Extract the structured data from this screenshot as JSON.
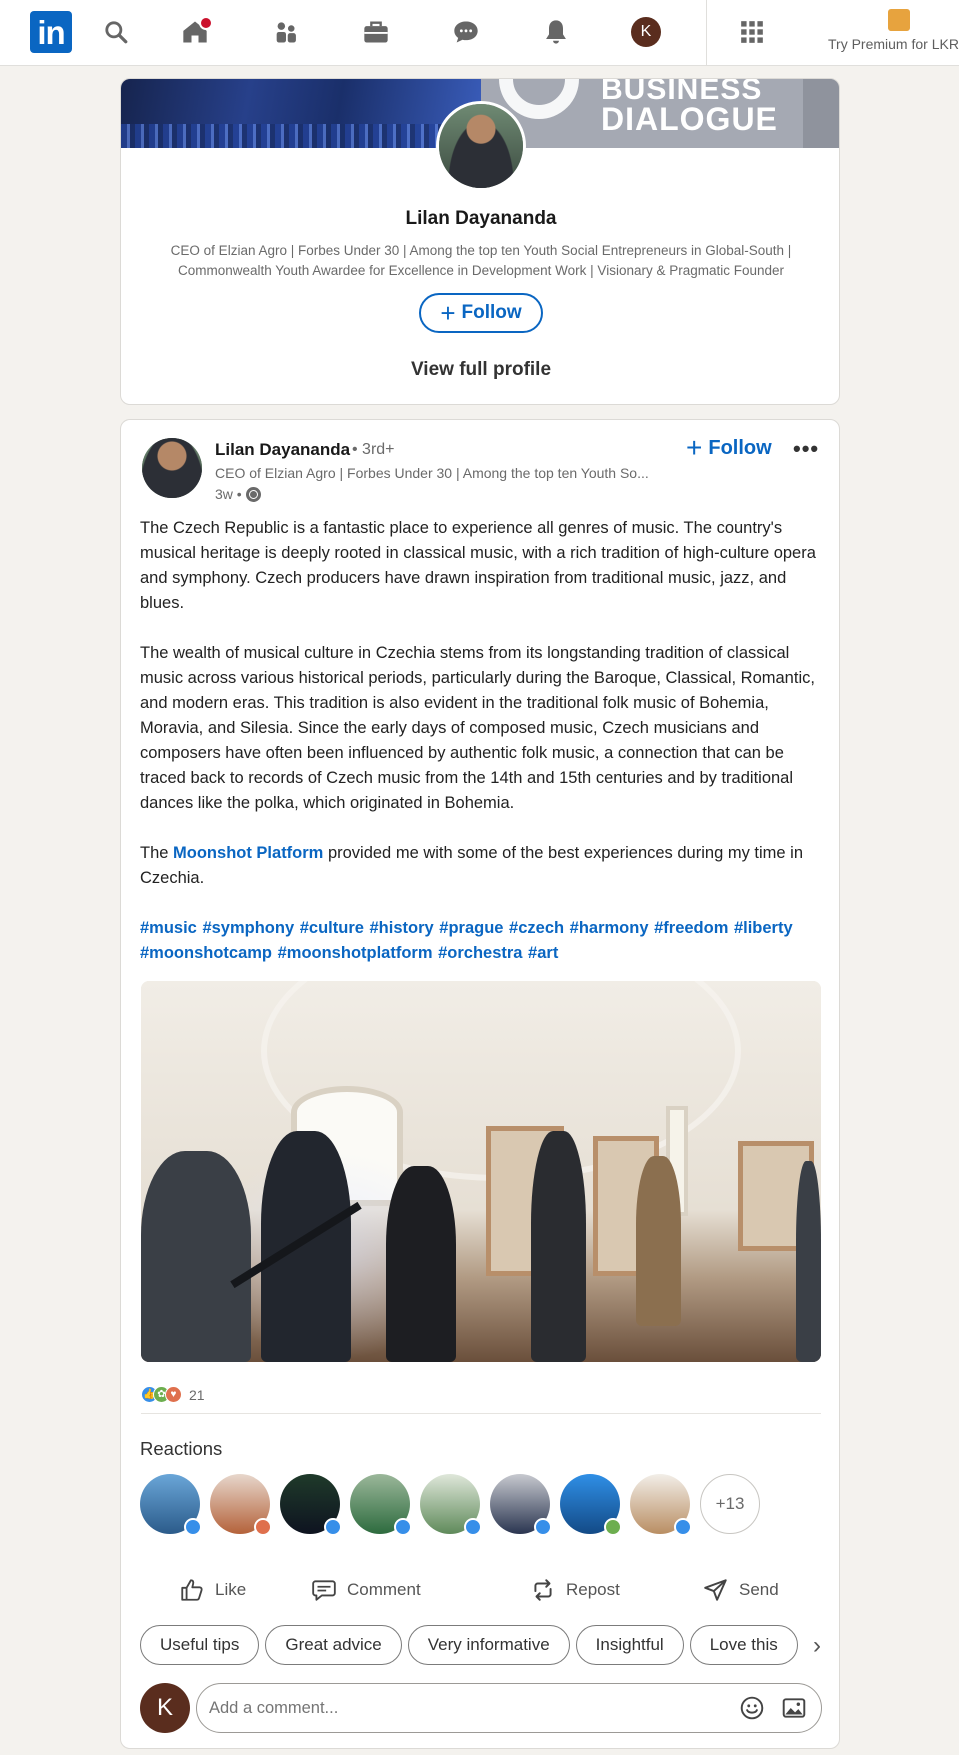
{
  "nav": {
    "logo": "in",
    "icons": [
      "search-icon",
      "home-icon",
      "my-network-icon",
      "jobs-icon",
      "messaging-icon",
      "notifications-icon",
      "me-avatar",
      "apps-grid-icon"
    ],
    "me_initial": "K",
    "premium_label": "Try Premium for LKR"
  },
  "profile": {
    "banner_line1": "BUSINESS",
    "banner_line2": "DIALOGUE",
    "name": "Lilan Dayananda",
    "headline": "CEO of Elzian Agro | Forbes Under 30 | Among the top ten Youth Social Entrepreneurs in Global-South | Commonwealth Youth Awardee for Excellence in Development Work | Visionary & Pragmatic Founder",
    "follow_label": "Follow",
    "view_profile_label": "View full profile"
  },
  "post": {
    "author_name": "Lilan Dayananda",
    "degree": "• 3rd+",
    "author_headline": "CEO of Elzian Agro | Forbes Under 30 | Among the top ten Youth So...",
    "time": "3w •",
    "follow_label": "Follow",
    "paragraph1": "The Czech Republic is a fantastic place to experience all genres of music. The country's musical heritage is deeply rooted in classical music, with a rich tradition of high-culture opera and symphony. Czech producers have drawn inspiration from traditional music, jazz, and blues.",
    "paragraph2": "The wealth of musical culture in Czechia stems from its longstanding tradition of classical music across various historical periods, particularly during the Baroque, Classical, Romantic, and modern eras. This tradition is also evident in the traditional folk music of Bohemia, Moravia, and Silesia. Since the early days of composed music, Czech musicians and composers have often been influenced by authentic folk music, a connection that can be traced back to records of Czech music from the 14th and 15th centuries and by traditional dances like the polka, which originated in Bohemia.",
    "paragraph3_before": "The ",
    "paragraph3_link": "Moonshot Platform",
    "paragraph3_after": " provided me with some of the best experiences during my time in Czechia.",
    "hashtags": "#music #symphony #culture #history #prague #czech #harmony #freedom #liberty #moonshotcamp #moonshotplatform #orchestra #art",
    "reaction_count": "21",
    "reactions_title": "Reactions",
    "more_reactors": "+13",
    "actions": {
      "like": "Like",
      "comment": "Comment",
      "repost": "Repost",
      "send": "Send"
    },
    "suggestions": [
      "Useful tips",
      "Great advice",
      "Very informative",
      "Insightful",
      "Love this"
    ],
    "commenter_initial": "K",
    "comment_placeholder": "Add a comment..."
  },
  "colors": {
    "brand_blue": "#0a66c2",
    "like_blue": "#378fe9",
    "love_orange": "#df704d",
    "support_green": "#6dae4f",
    "page_bg": "#f4f2ee"
  }
}
